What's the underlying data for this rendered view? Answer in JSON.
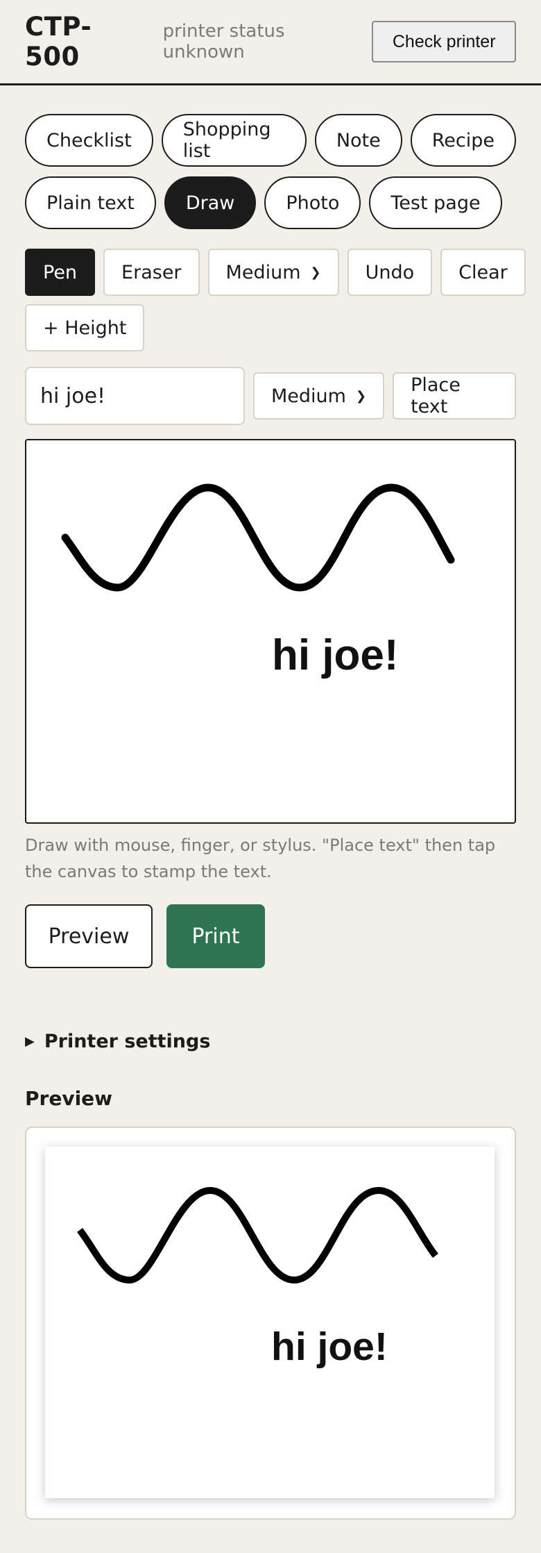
{
  "header": {
    "title": "CTP-500",
    "status": "printer status unknown",
    "check_button": "Check printer"
  },
  "modes": [
    {
      "label": "Checklist",
      "active": false
    },
    {
      "label": "Shopping list",
      "active": false
    },
    {
      "label": "Note",
      "active": false
    },
    {
      "label": "Recipe",
      "active": false
    },
    {
      "label": "Plain text",
      "active": false
    },
    {
      "label": "Draw",
      "active": true
    },
    {
      "label": "Photo",
      "active": false
    },
    {
      "label": "Test page",
      "active": false
    }
  ],
  "tools": {
    "pen": "Pen",
    "eraser": "Eraser",
    "brush_size": "Medium",
    "undo": "Undo",
    "clear": "Clear",
    "height": "+ Height",
    "active_tool": "pen"
  },
  "text_tool": {
    "input_value": "hi joe!",
    "size": "Medium",
    "place_button": "Place text"
  },
  "canvas": {
    "stamped_text": "hi joe!"
  },
  "hint": "Draw with mouse, finger, or stylus. \"Place text\" then tap the canvas to stamp the text.",
  "actions": {
    "preview": "Preview",
    "print": "Print"
  },
  "settings_label": "Printer settings",
  "preview": {
    "title": "Preview",
    "stamped_text": "hi joe!"
  },
  "colors": {
    "background": "#f3f0e9",
    "ink": "#1c1c1c",
    "print_button": "#2f7452",
    "muted_text": "#7a7a7a"
  }
}
